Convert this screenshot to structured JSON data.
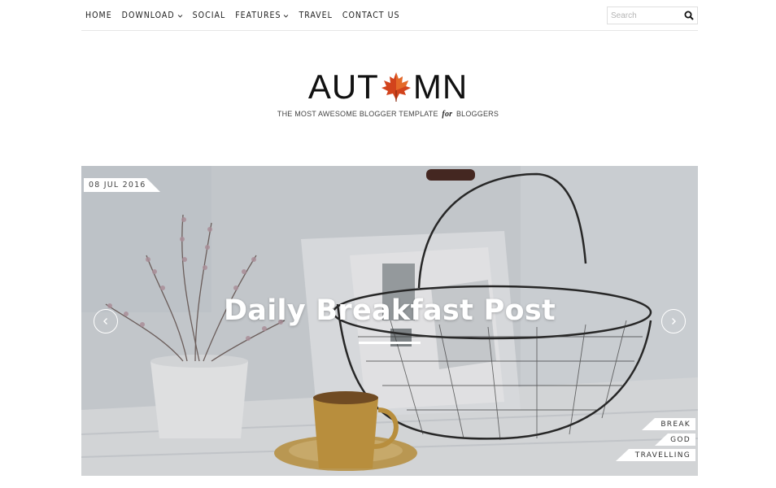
{
  "nav": {
    "items": [
      {
        "label": "HOME",
        "dropdown": false
      },
      {
        "label": "DOWNLOAD",
        "dropdown": true
      },
      {
        "label": "SOCIAL",
        "dropdown": false
      },
      {
        "label": "FEATURES",
        "dropdown": true
      },
      {
        "label": "TRAVEL",
        "dropdown": false
      },
      {
        "label": "CONTACT US",
        "dropdown": false
      }
    ],
    "search": {
      "placeholder": "Search",
      "icon": "search-icon"
    }
  },
  "logo": {
    "text_before": "AUT",
    "text_after": "MN",
    "leaf_icon": "maple-leaf-icon",
    "leaf_color": "#d2431c",
    "tagline_before": "THE MOST AWESOME BLOGGER TEMPLATE",
    "tagline_for": "for",
    "tagline_after": "BLOGGERS"
  },
  "slider": {
    "date": "08 JUL 2016",
    "title": "Daily Breakfast Post",
    "prev_icon": "chevron-left-icon",
    "next_icon": "chevron-right-icon",
    "tags": [
      {
        "label": "BREAK",
        "width": 66
      },
      {
        "label": "GOD",
        "width": 50
      },
      {
        "label": "TRAVELLING",
        "width": 98
      }
    ]
  }
}
